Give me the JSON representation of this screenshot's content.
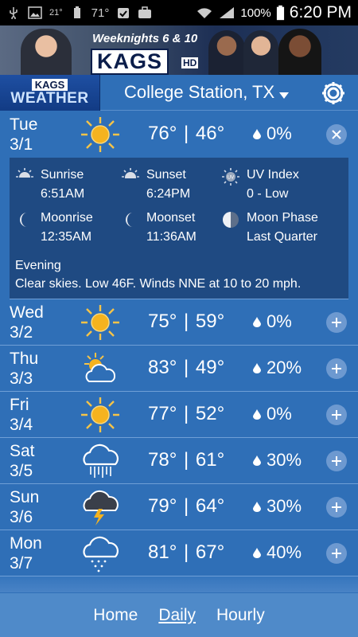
{
  "status_bar": {
    "time": "6:20 PM",
    "battery": "100%",
    "temp": "71°",
    "notification_count": "21°"
  },
  "ad_banner": {
    "tagline": "Weeknights 6 & 10",
    "logo": "KAGS",
    "logo_badge": "HD"
  },
  "header": {
    "brand_top": "KAGS",
    "brand_bottom": "WEATHER",
    "location": "College Station, TX",
    "settings_icon": "gear-icon"
  },
  "expanded_day": {
    "day": "Tue",
    "date": "3/1",
    "icon": "sunny-icon",
    "high": "76°",
    "low": "46°",
    "precip": "0%",
    "details": {
      "sunrise_label": "Sunrise",
      "sunrise": "6:51AM",
      "sunset_label": "Sunset",
      "sunset": "6:24PM",
      "uv_label": "UV Index",
      "uv": "0 - Low",
      "moonrise_label": "Moonrise",
      "moonrise": "12:35AM",
      "moonset_label": "Moonset",
      "moonset": "11:36AM",
      "moonphase_label": "Moon Phase",
      "moonphase": "Last Quarter",
      "period": "Evening",
      "forecast": "Clear skies. Low 46F. Winds NNE at 10 to 20 mph."
    }
  },
  "days": [
    {
      "day": "Wed",
      "date": "3/2",
      "icon": "sunny-icon",
      "high": "75°",
      "low": "59°",
      "precip": "0%"
    },
    {
      "day": "Thu",
      "date": "3/3",
      "icon": "partly-cloudy-icon",
      "high": "83°",
      "low": "49°",
      "precip": "20%"
    },
    {
      "day": "Fri",
      "date": "3/4",
      "icon": "sunny-icon",
      "high": "77°",
      "low": "52°",
      "precip": "0%"
    },
    {
      "day": "Sat",
      "date": "3/5",
      "icon": "rain-icon",
      "high": "78°",
      "low": "61°",
      "precip": "30%"
    },
    {
      "day": "Sun",
      "date": "3/6",
      "icon": "thunderstorm-icon",
      "high": "79°",
      "low": "64°",
      "precip": "30%"
    },
    {
      "day": "Mon",
      "date": "3/7",
      "icon": "showers-icon",
      "high": "81°",
      "low": "67°",
      "precip": "40%"
    }
  ],
  "bottom_nav": {
    "home": "Home",
    "daily": "Daily",
    "hourly": "Hourly",
    "active": "Daily"
  },
  "colors": {
    "background": "#2f6fb7",
    "details_panel": "#1f4a82",
    "sun": "#f5b31f",
    "nav": "#4f8ac9"
  }
}
